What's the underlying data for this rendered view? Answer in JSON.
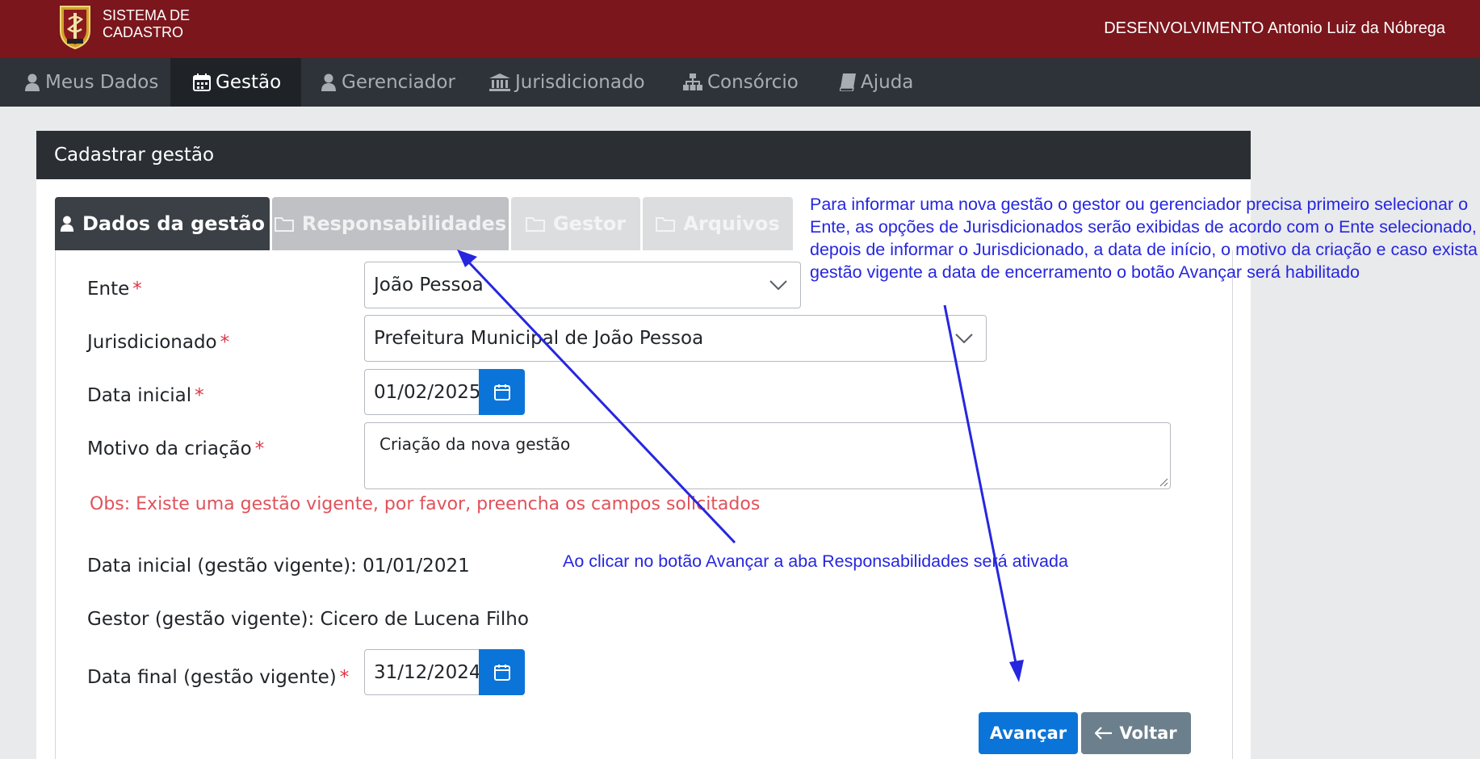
{
  "header": {
    "system_title": "SISTEMA DE CADASTRO",
    "user_info": "DESENVOLVIMENTO Antonio Luiz da Nóbrega"
  },
  "nav": [
    {
      "label": "Meus Dados",
      "icon": "user-icon"
    },
    {
      "label": "Gestão",
      "icon": "calendar-icon",
      "active": true
    },
    {
      "label": "Gerenciador",
      "icon": "user-icon"
    },
    {
      "label": "Jurisdicionado",
      "icon": "bank-icon"
    },
    {
      "label": "Consórcio",
      "icon": "sitemap-icon"
    },
    {
      "label": "Ajuda",
      "icon": "book-icon"
    }
  ],
  "card": {
    "title": "Cadastrar gestão"
  },
  "tabs": [
    {
      "label": "Dados da gestão",
      "icon": "user-icon",
      "state": "active"
    },
    {
      "label": "Responsabilidades",
      "icon": "folder-icon",
      "state": "disabled"
    },
    {
      "label": "Gestor",
      "icon": "folder-icon",
      "state": "disabled"
    },
    {
      "label": "Arquivos",
      "icon": "folder-icon",
      "state": "disabled"
    }
  ],
  "form": {
    "ente": {
      "label": "Ente",
      "value": "João Pessoa"
    },
    "jurisdicionado": {
      "label": "Jurisdicionado",
      "value": "Prefeitura Municipal de João Pessoa"
    },
    "data_inicial": {
      "label": "Data inicial",
      "value": "01/02/2025"
    },
    "motivo": {
      "label": "Motivo da criação",
      "value": "Criação da nova gestão"
    },
    "required_mark": "*",
    "obs": "Obs: Existe uma gestão vigente, por favor, preencha os campos solicitados",
    "vigente_data_inicial": "Data inicial (gestão vigente): 01/01/2021",
    "vigente_gestor": "Gestor (gestão vigente): Cicero de Lucena Filho",
    "data_final": {
      "label": "Data final (gestão vigente)",
      "value": "31/12/2024"
    }
  },
  "buttons": {
    "avancar": "Avançar",
    "voltar": "Voltar"
  },
  "annotations": {
    "note1": "Para informar uma nova gestão o gestor ou gerenciador precisa primeiro selecionar o Ente, as opções de Jurisdicionados serão exibidas de acordo com o Ente selecionado, depois de informar o Jurisdicionado, a data de início, o motivo da criação e caso exista gestão vigente a data de encerramento o botão Avançar será habilitado",
    "note2": "Ao clicar no botão Avançar a aba Responsabilidades será ativada"
  },
  "colors": {
    "topbar": "#7a161c",
    "navbar": "#2e3339",
    "primary": "#0b74d9",
    "annotation": "#2626e0",
    "required": "#dc3545"
  }
}
